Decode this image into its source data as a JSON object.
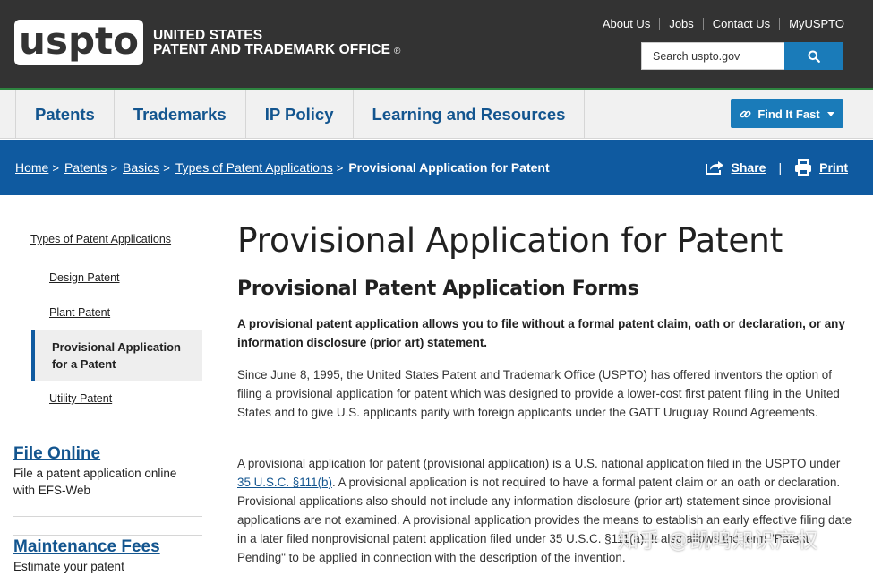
{
  "header": {
    "logo": "uspto",
    "agency_line1": "UNITED STATES",
    "agency_line2": "PATENT AND TRADEMARK OFFICE",
    "registered_mark": "®",
    "utility_links": [
      "About Us",
      "Jobs",
      "Contact Us",
      "MyUSPTO"
    ],
    "search_placeholder": "Search uspto.gov",
    "search_icon": "magnifier-icon"
  },
  "nav": {
    "items": [
      "Patents",
      "Trademarks",
      "IP Policy",
      "Learning and Resources"
    ],
    "find_it_fast": "Find It Fast"
  },
  "breadcrumb": {
    "items": [
      "Home",
      "Patents",
      "Basics",
      "Types of Patent Applications"
    ],
    "current": "Provisional Application for Patent",
    "separator": ">",
    "share": "Share",
    "print": "Print",
    "divider": "|"
  },
  "sidebar": {
    "parent": "Types of Patent Applications",
    "items": [
      "Design Patent",
      "Plant Patent"
    ],
    "active_line1": "Provisional Application",
    "active_line2": "for a Patent",
    "after_active": "Utility Patent",
    "blocks": [
      {
        "title": "File Online",
        "text": "File a patent application online with EFS-Web"
      },
      {
        "title": "Maintenance Fees",
        "text": "Estimate your patent"
      }
    ]
  },
  "content": {
    "title": "Provisional Application for Patent",
    "section_title": "Provisional Patent Application Forms",
    "lead": "A provisional patent application allows you to file without a formal patent claim, oath or declaration, or any information disclosure (prior art) statement.",
    "para1": "Since June 8, 1995, the United States Patent and Trademark Office (USPTO) has offered inventors the option of filing a provisional application for patent which was designed to provide a lower-cost first patent filing in the United States and to give U.S. applicants parity with foreign applicants under the GATT Uruguay Round Agreements.",
    "para2_before": "A provisional application for patent (provisional application) is a U.S. national application filed in the USPTO under ",
    "para2_link": "35 U.S.C. §111(b)",
    "para2_after": ". A provisional application is not required to have a formal patent claim or an oath or declaration. Provisional applications also should not include any information disclosure (prior art) statement since provisional applications are not examined. A provisional application provides the means to establish an early effective filing date in a later filed nonprovisional patent application filed under 35 U.S.C. §111(a). It also allows the term \"Patent Pending\" to be applied in connection with the description of the invention."
  },
  "watermark": "知乎 @凯鸣知识产权",
  "colors": {
    "header_bg": "#333333",
    "accent_blue": "#1a7bb9",
    "nav_text": "#13558f",
    "crumb_bg": "#0f5aa0",
    "green_rule": "#2e8540"
  }
}
